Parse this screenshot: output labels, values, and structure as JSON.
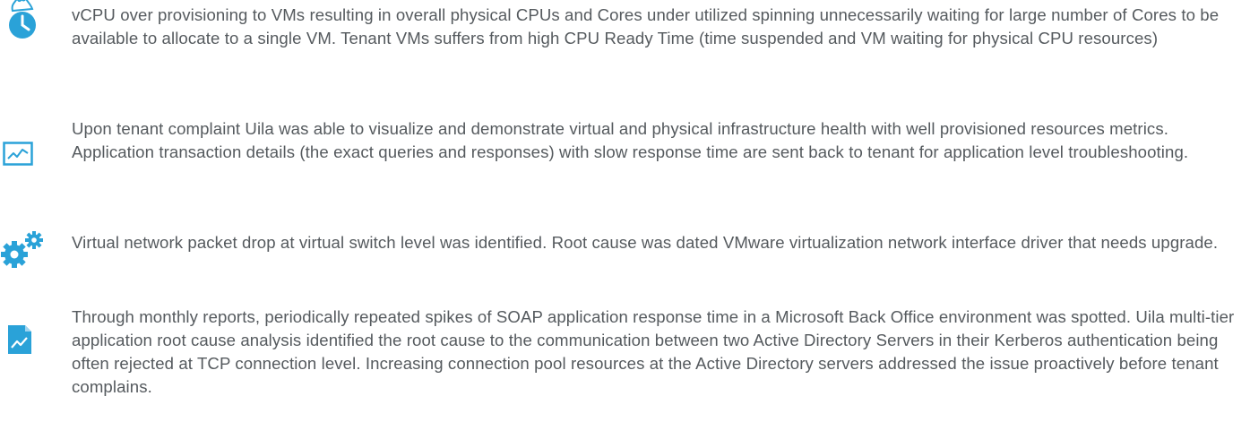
{
  "accent_color": "#2aa2d8",
  "items": [
    {
      "icon": "clock-icon",
      "text": "vCPU over provisioning to VMs resulting in overall physical CPUs and Cores under utilized spinning unnecessarily waiting for large number of Cores to be available to allocate to a single VM.   Tenant VMs suffers from high CPU Ready Time (time suspended and VM waiting for physical CPU resources)"
    },
    {
      "icon": "line-chart-icon",
      "text": "Upon tenant complaint Uila was able to visualize and demonstrate virtual and physical infrastructure health with well provisioned resources metrics. Application transaction details (the exact queries and responses) with slow response time are sent back to tenant for application level troubleshooting."
    },
    {
      "icon": "gears-icon",
      "text": "Virtual network packet drop at virtual switch level was identified.  Root cause was dated VMware virtualization network interface driver that needs upgrade."
    },
    {
      "icon": "report-icon",
      "text": "Through monthly reports, periodically repeated spikes of SOAP application response time in a Microsoft Back Office environment was spotted.  Uila multi-tier application root cause analysis identified the root cause to the communication between two Active Directory Servers in their Kerberos authentication being often rejected at TCP connection level.  Increasing connection pool resources at the Active Directory servers addressed the issue proactively before tenant complains."
    }
  ]
}
